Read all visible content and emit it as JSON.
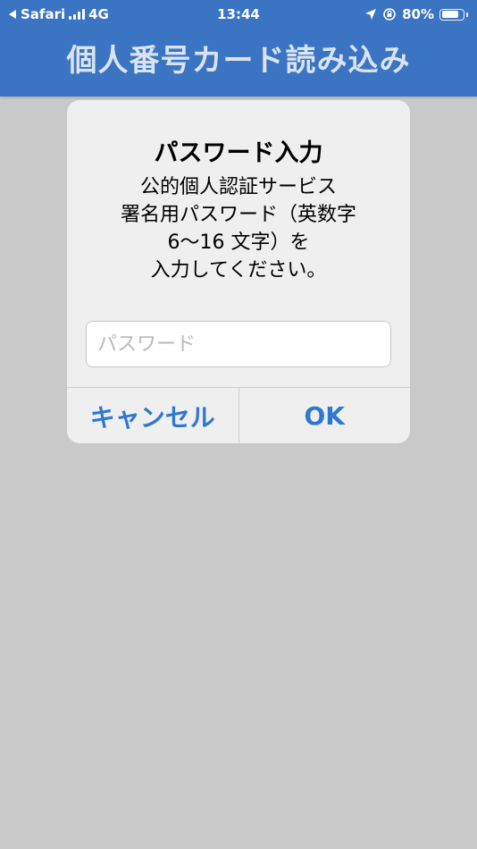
{
  "status_bar": {
    "back_label": "Safari",
    "network": "4G",
    "time": "13:44",
    "battery_percent_label": "80%",
    "battery_level": 0.8
  },
  "header": {
    "title": "個人番号カード読み込み"
  },
  "alert": {
    "title": "パスワード入力",
    "message_lines": [
      "公的個人認証サービス",
      "署名用パスワード（英数字",
      "6〜16 文字）を",
      "入力してください。"
    ],
    "password_placeholder": "パスワード",
    "password_value": "",
    "cancel_label": "キャンセル",
    "ok_label": "OK"
  },
  "colors": {
    "header_bg": "#3a74c3",
    "accent": "#2f78d2",
    "backdrop": "#c9c9c9"
  }
}
